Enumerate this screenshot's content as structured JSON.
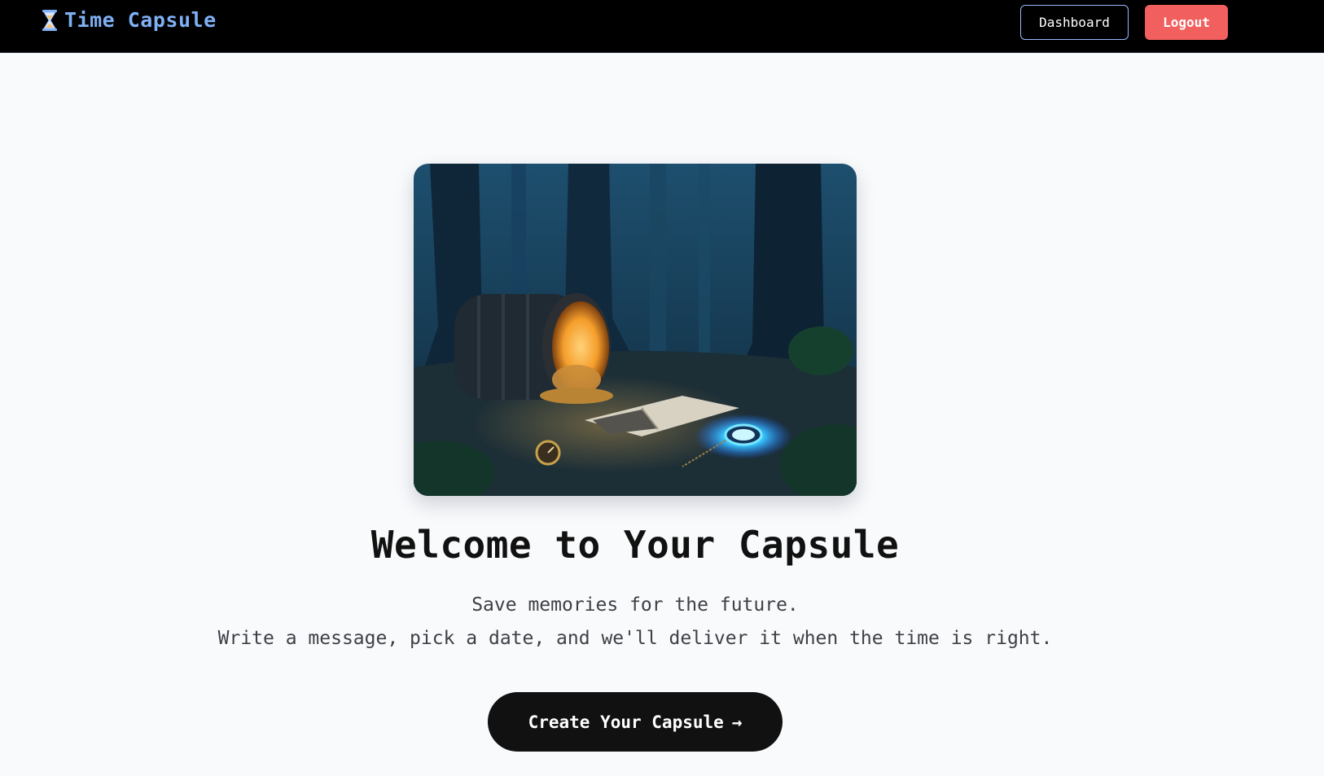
{
  "nav": {
    "brand": "Time Capsule",
    "brand_icon": "hourglass-icon",
    "dashboard_label": "Dashboard",
    "logout_label": "Logout"
  },
  "hero": {
    "image_icon": "forest-time-capsule-illustration",
    "headline": "Welcome to Your Capsule",
    "subline_1": "Save memories for the future.",
    "subline_2": "Write a message, pick a date, and we'll deliver it when the time is right.",
    "cta_label": "Create Your Capsule",
    "cta_icon": "arrow-right-icon"
  },
  "colors": {
    "nav_bg": "#000000",
    "brand": "#7fb0f5",
    "logout_bg": "#f25f5f",
    "page_bg": "#f8fafc",
    "cta_bg": "#111111"
  }
}
